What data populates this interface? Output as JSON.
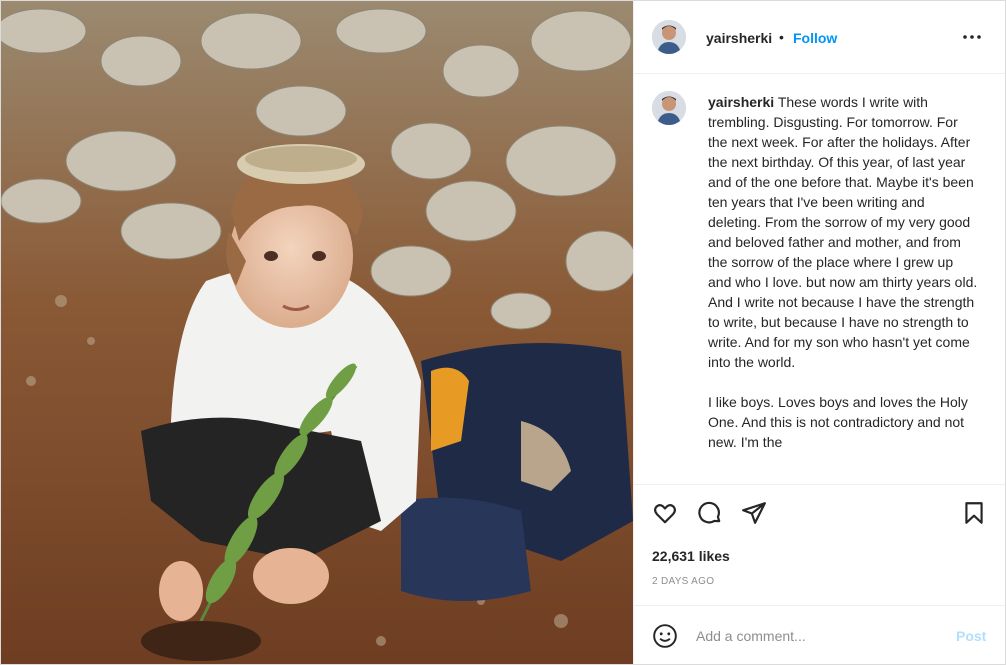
{
  "post": {
    "username": "yairsherki",
    "follow_label": "Follow",
    "separator": "•",
    "photo_alt": "Boy in kippah planting a pine sapling",
    "caption_para1": "These words I write with trembling. Disgusting. For tomorrow. For the next week. For after the holidays. After the next birthday. Of this year, of last year and of the one before that. Maybe it's been ten years that I've been writing and deleting. From the sorrow of my very good and beloved father and mother, and from the sorrow of the place where I grew up and who I love. but now am thirty years old. And I write not because I have the strength to write, but because I have no strength to write. And for my son who hasn't yet come into the world.",
    "caption_para2": "I like boys. Loves boys and loves the Holy One. And this is not contradictory and not new. I'm the",
    "likes": "22,631 likes",
    "date": "2 DAYS AGO"
  },
  "comment": {
    "placeholder": "Add a comment...",
    "post_label": "Post"
  },
  "icons": {
    "like": "heart-icon",
    "comment": "comment-bubble-icon",
    "share": "paper-plane-icon",
    "save": "bookmark-icon",
    "more": "more-dots-icon",
    "emoji": "emoji-smile-icon"
  },
  "colors": {
    "accent": "#0095f6",
    "post_disabled": "#b2dffc",
    "text": "#262626",
    "muted": "#8e8e8e"
  }
}
